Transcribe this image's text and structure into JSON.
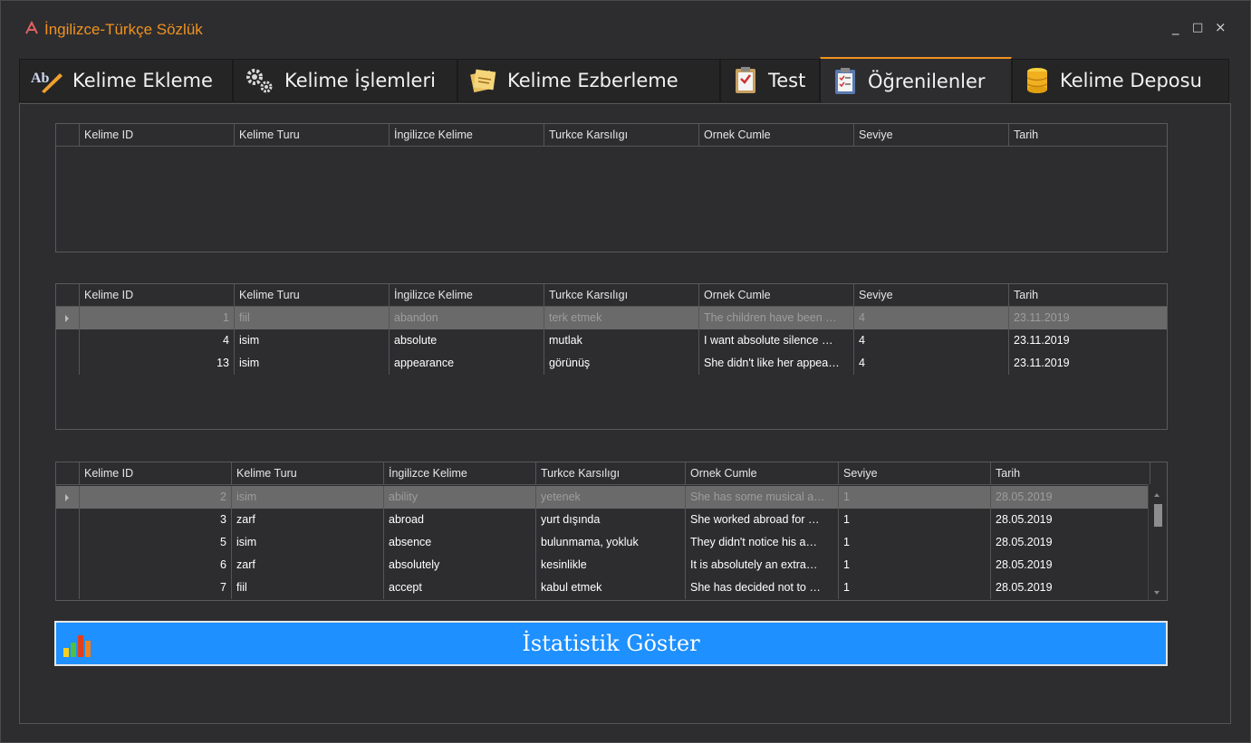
{
  "app": {
    "title": "İngilizce-Türkçe Sözlük",
    "icon": "app-logo-icon"
  },
  "window_controls": {
    "minimize": "_",
    "maximize": "□",
    "close": "×"
  },
  "tabs": [
    {
      "label": "Kelime Ekleme",
      "icon": "ab-pencil-icon"
    },
    {
      "label": "Kelime İşlemleri",
      "icon": "gears-icon"
    },
    {
      "label": "Kelime Ezberleme",
      "icon": "notes-icon"
    },
    {
      "label": "Test",
      "icon": "clipboard-check-icon"
    },
    {
      "label": "Öğrenilenler",
      "icon": "clipboard-list-icon",
      "active": true
    },
    {
      "label": "Kelime Deposu",
      "icon": "database-icon"
    }
  ],
  "columns": [
    "Kelime ID",
    "Kelime Turu",
    "İngilizce Kelime",
    "Turkce Karsılıgı",
    "Ornek Cumle",
    "Seviye",
    "Tarih"
  ],
  "grid1": {
    "rows": []
  },
  "grid2": {
    "rows": [
      [
        "1",
        "fiil",
        "abandon",
        "terk etmek",
        "The children have been …",
        "4",
        "23.11.2019"
      ],
      [
        "4",
        "isim",
        " absolute",
        "mutlak",
        "I want absolute silence …",
        "4",
        "23.11.2019"
      ],
      [
        "13",
        "isim",
        "appearance",
        "görünüş",
        "She didn't like her appea…",
        "4",
        "23.11.2019"
      ]
    ]
  },
  "grid3": {
    "rows": [
      [
        "2",
        "isim",
        "ability",
        "yetenek",
        "She has some musical a…",
        "1",
        "28.05.2019"
      ],
      [
        "3",
        "zarf",
        "abroad",
        "yurt dışında",
        "She worked abroad for …",
        "1",
        "28.05.2019"
      ],
      [
        "5",
        "isim",
        "absence",
        "bulunmama, yokluk",
        "They didn't notice his a…",
        "1",
        "28.05.2019"
      ],
      [
        "6",
        "zarf",
        "absolutely",
        "kesinlikle",
        "It is absolutely an extra…",
        "1",
        "28.05.2019"
      ],
      [
        "7",
        "fiil",
        "accept",
        "kabul etmek",
        "She has decided not to …",
        "1",
        "28.05.2019"
      ]
    ]
  },
  "stat_button": {
    "label": "İstatistik Göster",
    "icon": "bar-chart-icon"
  },
  "colors": {
    "accent": "#f0921e",
    "button": "#1e90ff",
    "background": "#2d2d30",
    "selected_row": "#6a6a6a"
  }
}
